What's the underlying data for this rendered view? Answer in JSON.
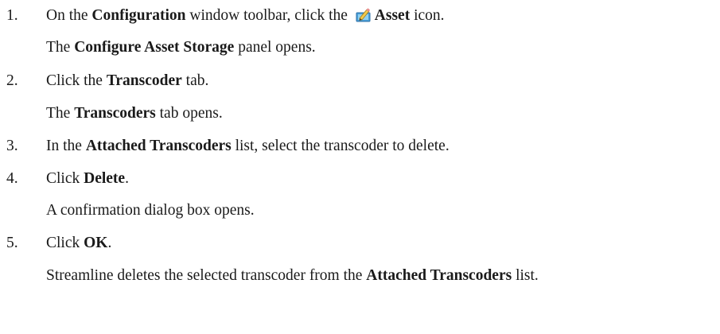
{
  "steps": [
    {
      "number": "1.",
      "pre": "On the ",
      "b1": "Configuration",
      "mid": " window toolbar, click the ",
      "icon": "asset-icon",
      "b2": "Asset",
      "post": " icon.",
      "result": {
        "pre": "The ",
        "bold": "Configure Asset Storage",
        "post": " panel opens."
      }
    },
    {
      "number": "2.",
      "pre": "Click the ",
      "bold": "Transcoder",
      "post": " tab.",
      "result": {
        "pre": "The ",
        "bold": "Transcoders",
        "post": " tab opens."
      }
    },
    {
      "number": "3.",
      "pre": "In the ",
      "bold": "Attached Transcoders",
      "post": " list, select the transcoder to delete."
    },
    {
      "number": "4.",
      "pre": "Click ",
      "bold": "Delete",
      "post": ".",
      "result": {
        "text": "A confirmation dialog box opens."
      }
    },
    {
      "number": "5.",
      "pre": "Click ",
      "bold": "OK",
      "post": ".",
      "result": {
        "pre": "Streamline deletes the selected transcoder from the ",
        "bold": "Attached Transcoders",
        "post": " list."
      }
    }
  ]
}
